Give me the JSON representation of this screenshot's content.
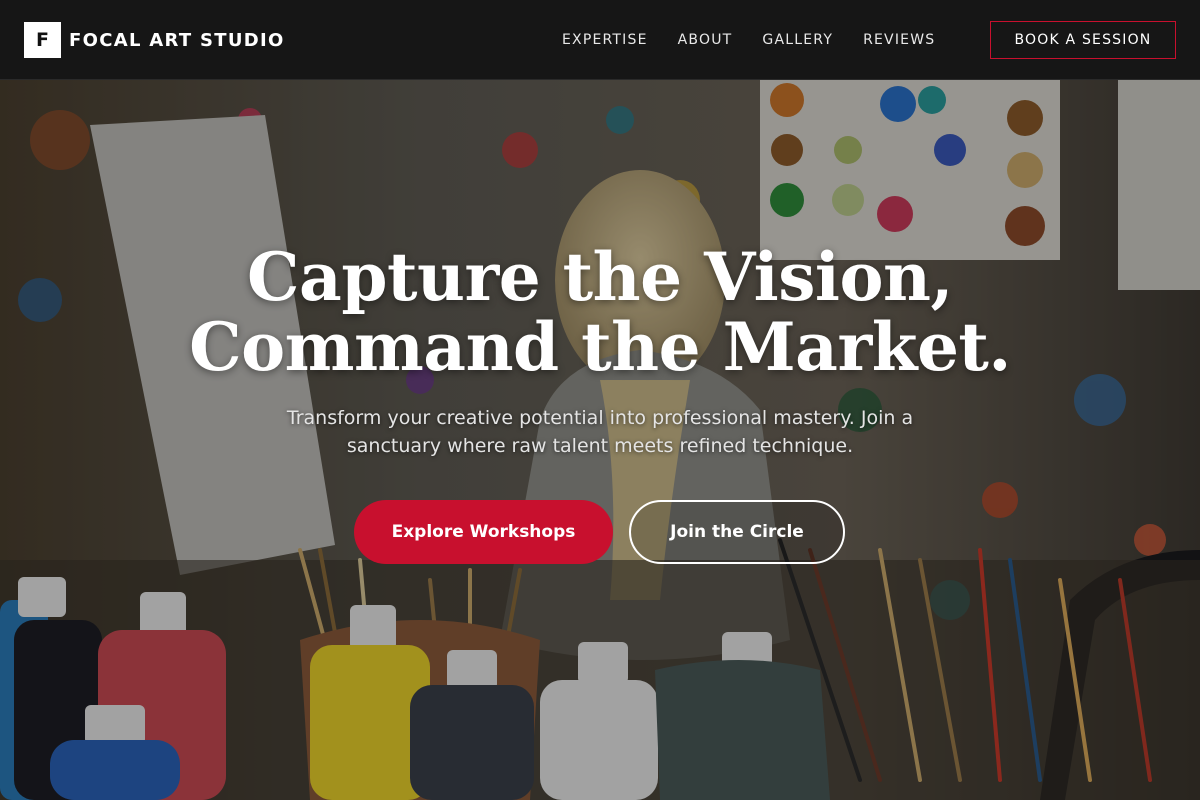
{
  "brand": {
    "logo_letter": "F",
    "name": "FOCAL ART STUDIO",
    "accent_color": "#c8102e"
  },
  "nav": {
    "links": [
      {
        "label": "EXPERTISE"
      },
      {
        "label": "ABOUT"
      },
      {
        "label": "GALLERY"
      },
      {
        "label": "REVIEWS"
      }
    ],
    "cta_label": "BOOK A SESSION"
  },
  "hero": {
    "title_line1": "Capture the Vision,",
    "title_line2": "Command the Market.",
    "subtitle": "Transform your creative potential into professional mastery. Join a sanctuary where raw talent meets refined technique.",
    "primary_cta": "Explore Workshops",
    "secondary_cta": "Join the Circle",
    "background_subject": "art studio with paint-splattered walls, child painting, paint bottles and brushes"
  }
}
